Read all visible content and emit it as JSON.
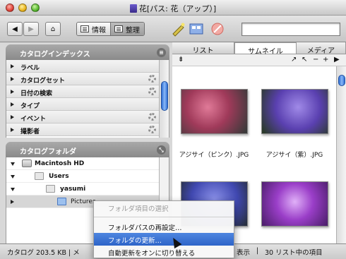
{
  "window": {
    "title": "花[パス: 花（アップ）]"
  },
  "toolbar": {
    "back_label": "◀",
    "forward_label": "▶",
    "home_label": "⌂",
    "view_info_label": "情報",
    "view_organize_label": "整理",
    "search_value": ""
  },
  "catalog_index": {
    "header": "カタログインデックス",
    "items": [
      {
        "label": "ラベル",
        "has_gear": false
      },
      {
        "label": "カタログセット",
        "has_gear": true
      },
      {
        "label": "日付の検索",
        "has_gear": true
      },
      {
        "label": "タイプ",
        "has_gear": false
      },
      {
        "label": "イベント",
        "has_gear": true
      },
      {
        "label": "撮影者",
        "has_gear": true
      }
    ]
  },
  "catalog_folders": {
    "header": "カタログフォルダ",
    "items": [
      {
        "label": "Macintosh HD",
        "expanded": true,
        "level": 0
      },
      {
        "label": "Users",
        "expanded": true,
        "level": 1
      },
      {
        "label": "yasumi",
        "expanded": true,
        "level": 2
      },
      {
        "label": "Pictures",
        "expanded": false,
        "level": 3
      }
    ]
  },
  "tabs": [
    "リスト",
    "サムネイル",
    "メディア"
  ],
  "active_tab": "サムネイル",
  "thumbnails": [
    {
      "caption": "アジサイ（ピンク）.JPG",
      "color": "#c0506e"
    },
    {
      "caption": "アジサイ（紫）.JPG",
      "color": "#7a5cc8"
    },
    {
      "caption": "",
      "color": "#5a60c0"
    },
    {
      "caption": "",
      "color": "#9a3ec8"
    }
  ],
  "status": {
    "left": "カタログ 203.5 KB | メ",
    "mid": "表示",
    "right": "30 リスト中の項目"
  },
  "context_menu": {
    "items": [
      {
        "label": "フォルダ項目の選択",
        "state": "disabled"
      },
      {
        "label": "フォルダパスの再設定…",
        "state": "normal"
      },
      {
        "label": "フォルダの更新…",
        "state": "highlighted"
      },
      {
        "label": "自動更新をオンに切り替える",
        "state": "normal"
      }
    ]
  },
  "colors": {
    "selection": "#2d64c8",
    "scroll_thumb": "#2f6fd6"
  }
}
